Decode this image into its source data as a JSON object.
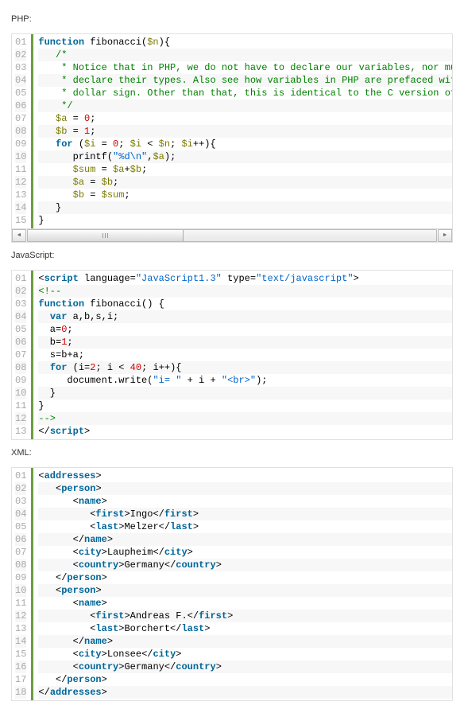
{
  "sections": [
    {
      "label": "PHP:",
      "scrollbar": true,
      "lines": [
        [
          [
            "kw",
            "function"
          ],
          [
            "op",
            " "
          ],
          [
            "fn",
            "fibonacci"
          ],
          [
            "op",
            "("
          ],
          [
            "var",
            "$n"
          ],
          [
            "op",
            "){"
          ]
        ],
        [
          [
            "op",
            "   "
          ],
          [
            "com",
            "/*"
          ]
        ],
        [
          [
            "op",
            "    "
          ],
          [
            "com",
            "* Notice that in PHP, we do not have to declare our variables, nor mu"
          ]
        ],
        [
          [
            "op",
            "    "
          ],
          [
            "com",
            "* declare their types. Also see how variables in PHP are prefaced wit"
          ]
        ],
        [
          [
            "op",
            "    "
          ],
          [
            "com",
            "* dollar sign. Other than that, this is identical to the C version of"
          ]
        ],
        [
          [
            "op",
            "    "
          ],
          [
            "com",
            "*/"
          ]
        ],
        [
          [
            "op",
            "   "
          ],
          [
            "var",
            "$a"
          ],
          [
            "op",
            " = "
          ],
          [
            "num",
            "0"
          ],
          [
            "op",
            ";"
          ]
        ],
        [
          [
            "op",
            "   "
          ],
          [
            "var",
            "$b"
          ],
          [
            "op",
            " = "
          ],
          [
            "num",
            "1"
          ],
          [
            "op",
            ";"
          ]
        ],
        [
          [
            "op",
            "   "
          ],
          [
            "kw",
            "for"
          ],
          [
            "op",
            " ("
          ],
          [
            "var",
            "$i"
          ],
          [
            "op",
            " = "
          ],
          [
            "num",
            "0"
          ],
          [
            "op",
            "; "
          ],
          [
            "var",
            "$i"
          ],
          [
            "op",
            " < "
          ],
          [
            "var",
            "$n"
          ],
          [
            "op",
            "; "
          ],
          [
            "var",
            "$i"
          ],
          [
            "op",
            "++){"
          ]
        ],
        [
          [
            "op",
            "      "
          ],
          [
            "fn",
            "printf"
          ],
          [
            "op",
            "("
          ],
          [
            "str",
            "\"%d\\n\""
          ],
          [
            "op",
            ","
          ],
          [
            "var",
            "$a"
          ],
          [
            "op",
            ");"
          ]
        ],
        [
          [
            "op",
            "      "
          ],
          [
            "var",
            "$sum"
          ],
          [
            "op",
            " = "
          ],
          [
            "var",
            "$a"
          ],
          [
            "op",
            "+"
          ],
          [
            "var",
            "$b"
          ],
          [
            "op",
            ";"
          ]
        ],
        [
          [
            "op",
            "      "
          ],
          [
            "var",
            "$a"
          ],
          [
            "op",
            " = "
          ],
          [
            "var",
            "$b"
          ],
          [
            "op",
            ";"
          ]
        ],
        [
          [
            "op",
            "      "
          ],
          [
            "var",
            "$b"
          ],
          [
            "op",
            " = "
          ],
          [
            "var",
            "$sum"
          ],
          [
            "op",
            ";"
          ]
        ],
        [
          [
            "op",
            "   "
          ],
          [
            "op",
            "}"
          ]
        ],
        [
          [
            "op",
            "}"
          ]
        ]
      ]
    },
    {
      "label": "JavaScript:",
      "scrollbar": false,
      "lines": [
        [
          [
            "op",
            "<"
          ],
          [
            "tag",
            "script"
          ],
          [
            "op",
            " language="
          ],
          [
            "str",
            "\"JavaScript1.3\""
          ],
          [
            "op",
            " type="
          ],
          [
            "str",
            "\"text/javascript\""
          ],
          [
            "op",
            ">"
          ]
        ],
        [
          [
            "com",
            "<!--"
          ]
        ],
        [
          [
            "kw",
            "function"
          ],
          [
            "op",
            " "
          ],
          [
            "fn",
            "fibonacci"
          ],
          [
            "op",
            "() {"
          ]
        ],
        [
          [
            "op",
            "  "
          ],
          [
            "kw",
            "var"
          ],
          [
            "op",
            " a,b,s,i;"
          ]
        ],
        [
          [
            "op",
            "  a="
          ],
          [
            "num",
            "0"
          ],
          [
            "op",
            ";"
          ]
        ],
        [
          [
            "op",
            "  b="
          ],
          [
            "num",
            "1"
          ],
          [
            "op",
            ";"
          ]
        ],
        [
          [
            "op",
            "  s=b+a;"
          ]
        ],
        [
          [
            "op",
            "  "
          ],
          [
            "kw",
            "for"
          ],
          [
            "op",
            " (i="
          ],
          [
            "num",
            "2"
          ],
          [
            "op",
            "; i < "
          ],
          [
            "num",
            "40"
          ],
          [
            "op",
            "; i++){"
          ]
        ],
        [
          [
            "op",
            "     document.write("
          ],
          [
            "str",
            "\"i= \""
          ],
          [
            "op",
            " + i + "
          ],
          [
            "str",
            "\"<br>\""
          ],
          [
            "op",
            ");"
          ]
        ],
        [
          [
            "op",
            "  }"
          ]
        ],
        [
          [
            "op",
            "}"
          ]
        ],
        [
          [
            "com",
            "-->"
          ]
        ],
        [
          [
            "op",
            "</"
          ],
          [
            "tag",
            "script"
          ],
          [
            "op",
            ">"
          ]
        ]
      ]
    },
    {
      "label": "XML:",
      "scrollbar": false,
      "lines": [
        [
          [
            "op",
            "<"
          ],
          [
            "tag",
            "addresses"
          ],
          [
            "op",
            ">"
          ]
        ],
        [
          [
            "op",
            "   <"
          ],
          [
            "tag",
            "person"
          ],
          [
            "op",
            ">"
          ]
        ],
        [
          [
            "op",
            "      <"
          ],
          [
            "tag",
            "name"
          ],
          [
            "op",
            ">"
          ]
        ],
        [
          [
            "op",
            "         <"
          ],
          [
            "tag",
            "first"
          ],
          [
            "op",
            ">"
          ],
          [
            "txt",
            "Ingo"
          ],
          [
            "op",
            "</"
          ],
          [
            "tag",
            "first"
          ],
          [
            "op",
            ">"
          ]
        ],
        [
          [
            "op",
            "         <"
          ],
          [
            "tag",
            "last"
          ],
          [
            "op",
            ">"
          ],
          [
            "txt",
            "Melzer"
          ],
          [
            "op",
            "</"
          ],
          [
            "tag",
            "last"
          ],
          [
            "op",
            ">"
          ]
        ],
        [
          [
            "op",
            "      </"
          ],
          [
            "tag",
            "name"
          ],
          [
            "op",
            ">"
          ]
        ],
        [
          [
            "op",
            "      <"
          ],
          [
            "tag",
            "city"
          ],
          [
            "op",
            ">"
          ],
          [
            "txt",
            "Laupheim"
          ],
          [
            "op",
            "</"
          ],
          [
            "tag",
            "city"
          ],
          [
            "op",
            ">"
          ]
        ],
        [
          [
            "op",
            "      <"
          ],
          [
            "tag",
            "country"
          ],
          [
            "op",
            ">"
          ],
          [
            "txt",
            "Germany"
          ],
          [
            "op",
            "</"
          ],
          [
            "tag",
            "country"
          ],
          [
            "op",
            ">"
          ]
        ],
        [
          [
            "op",
            "   </"
          ],
          [
            "tag",
            "person"
          ],
          [
            "op",
            ">"
          ]
        ],
        [
          [
            "op",
            "   <"
          ],
          [
            "tag",
            "person"
          ],
          [
            "op",
            ">"
          ]
        ],
        [
          [
            "op",
            "      <"
          ],
          [
            "tag",
            "name"
          ],
          [
            "op",
            ">"
          ]
        ],
        [
          [
            "op",
            "         <"
          ],
          [
            "tag",
            "first"
          ],
          [
            "op",
            ">"
          ],
          [
            "txt",
            "Andreas F."
          ],
          [
            "op",
            "</"
          ],
          [
            "tag",
            "first"
          ],
          [
            "op",
            ">"
          ]
        ],
        [
          [
            "op",
            "         <"
          ],
          [
            "tag",
            "last"
          ],
          [
            "op",
            ">"
          ],
          [
            "txt",
            "Borchert"
          ],
          [
            "op",
            "</"
          ],
          [
            "tag",
            "last"
          ],
          [
            "op",
            ">"
          ]
        ],
        [
          [
            "op",
            "      </"
          ],
          [
            "tag",
            "name"
          ],
          [
            "op",
            ">"
          ]
        ],
        [
          [
            "op",
            "      <"
          ],
          [
            "tag",
            "city"
          ],
          [
            "op",
            ">"
          ],
          [
            "txt",
            "Lonsee"
          ],
          [
            "op",
            "</"
          ],
          [
            "tag",
            "city"
          ],
          [
            "op",
            ">"
          ]
        ],
        [
          [
            "op",
            "      <"
          ],
          [
            "tag",
            "country"
          ],
          [
            "op",
            ">"
          ],
          [
            "txt",
            "Germany"
          ],
          [
            "op",
            "</"
          ],
          [
            "tag",
            "country"
          ],
          [
            "op",
            ">"
          ]
        ],
        [
          [
            "op",
            "   </"
          ],
          [
            "tag",
            "person"
          ],
          [
            "op",
            ">"
          ]
        ],
        [
          [
            "op",
            "</"
          ],
          [
            "tag",
            "addresses"
          ],
          [
            "op",
            ">"
          ]
        ]
      ]
    }
  ]
}
